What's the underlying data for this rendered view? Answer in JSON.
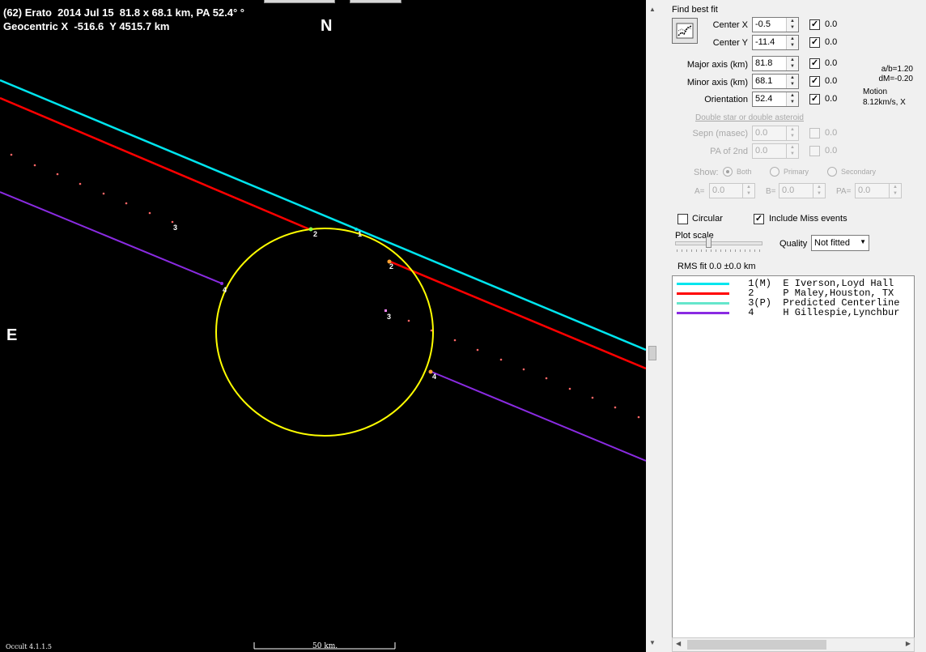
{
  "plot": {
    "title_line1": "(62) Erato  2014 Jul 15  81.8 x 68.1 km, PA 52.4° °",
    "title_line2": "Geocentric X  -516.6  Y 4515.7 km",
    "north_label": "N",
    "east_label": "E",
    "version": "Occult 4.1.1.5",
    "scale_label": "50 km.",
    "chord_labels": [
      "1",
      "2",
      "2",
      "3",
      "3",
      "4",
      "4"
    ],
    "colors": {
      "background": "#000000",
      "ellipse": "#ffff00",
      "chord_1": "#00e5ee",
      "chord_2": "#ff0000",
      "chord_3_dots": "#ff6666",
      "chord_4": "#8a2be2"
    }
  },
  "panel": {
    "find_best_fit_label": "Find best fit",
    "center_x": {
      "label": "Center X",
      "value": "-0.5",
      "checked": true,
      "fit": "0.0"
    },
    "center_y": {
      "label": "Center Y",
      "value": "-11.4",
      "checked": true,
      "fit": "0.0"
    },
    "major_axis": {
      "label": "Major axis (km)",
      "value": "81.8",
      "checked": true,
      "fit": "0.0"
    },
    "minor_axis": {
      "label": "Minor axis (km)",
      "value": "68.1",
      "checked": true,
      "fit": "0.0"
    },
    "orientation": {
      "label": "Orientation",
      "value": "52.4",
      "checked": true,
      "fit": "0.0"
    },
    "ratio_ab": "a/b=1.20",
    "ratio_dm": "dM=-0.20",
    "motion_label": "Motion",
    "motion_value": "8.12km/s, X",
    "double_star_label": "Double star  or  double asteroid",
    "sepn": {
      "label": "Sepn (masec)",
      "value": "0.0",
      "fit": "0.0"
    },
    "pa_2nd": {
      "label": "PA of 2nd",
      "value": "0.0",
      "fit": "0.0"
    },
    "show_label": "Show:",
    "show_options": [
      "Both",
      "Primary",
      "Secondary"
    ],
    "show_selected": "Both",
    "a_field": {
      "label": "A=",
      "value": "0.0"
    },
    "b_field": {
      "label": "B=",
      "value": "0.0"
    },
    "pa_field": {
      "label": "PA=",
      "value": "0.0"
    },
    "circular_label": "Circular",
    "circular_checked": false,
    "include_miss_label": "Include Miss events",
    "include_miss_checked": true,
    "plot_scale_label": "Plot scale",
    "quality_label": "Quality",
    "quality_value": "Not fitted",
    "rms_label": "RMS fit 0.0 ±0.0 km"
  },
  "legend": [
    {
      "text": " 1(M)  E Iverson,Loyd Hall",
      "color": "#00e5ee"
    },
    {
      "text": " 2     P Maley,Houston, TX",
      "color": "#ff0000"
    },
    {
      "text": " 3(P)  Predicted Centerline",
      "color": "#66e6cc"
    },
    {
      "text": " 4     H Gillespie,Lynchbur",
      "color": "#8a2be2"
    }
  ]
}
